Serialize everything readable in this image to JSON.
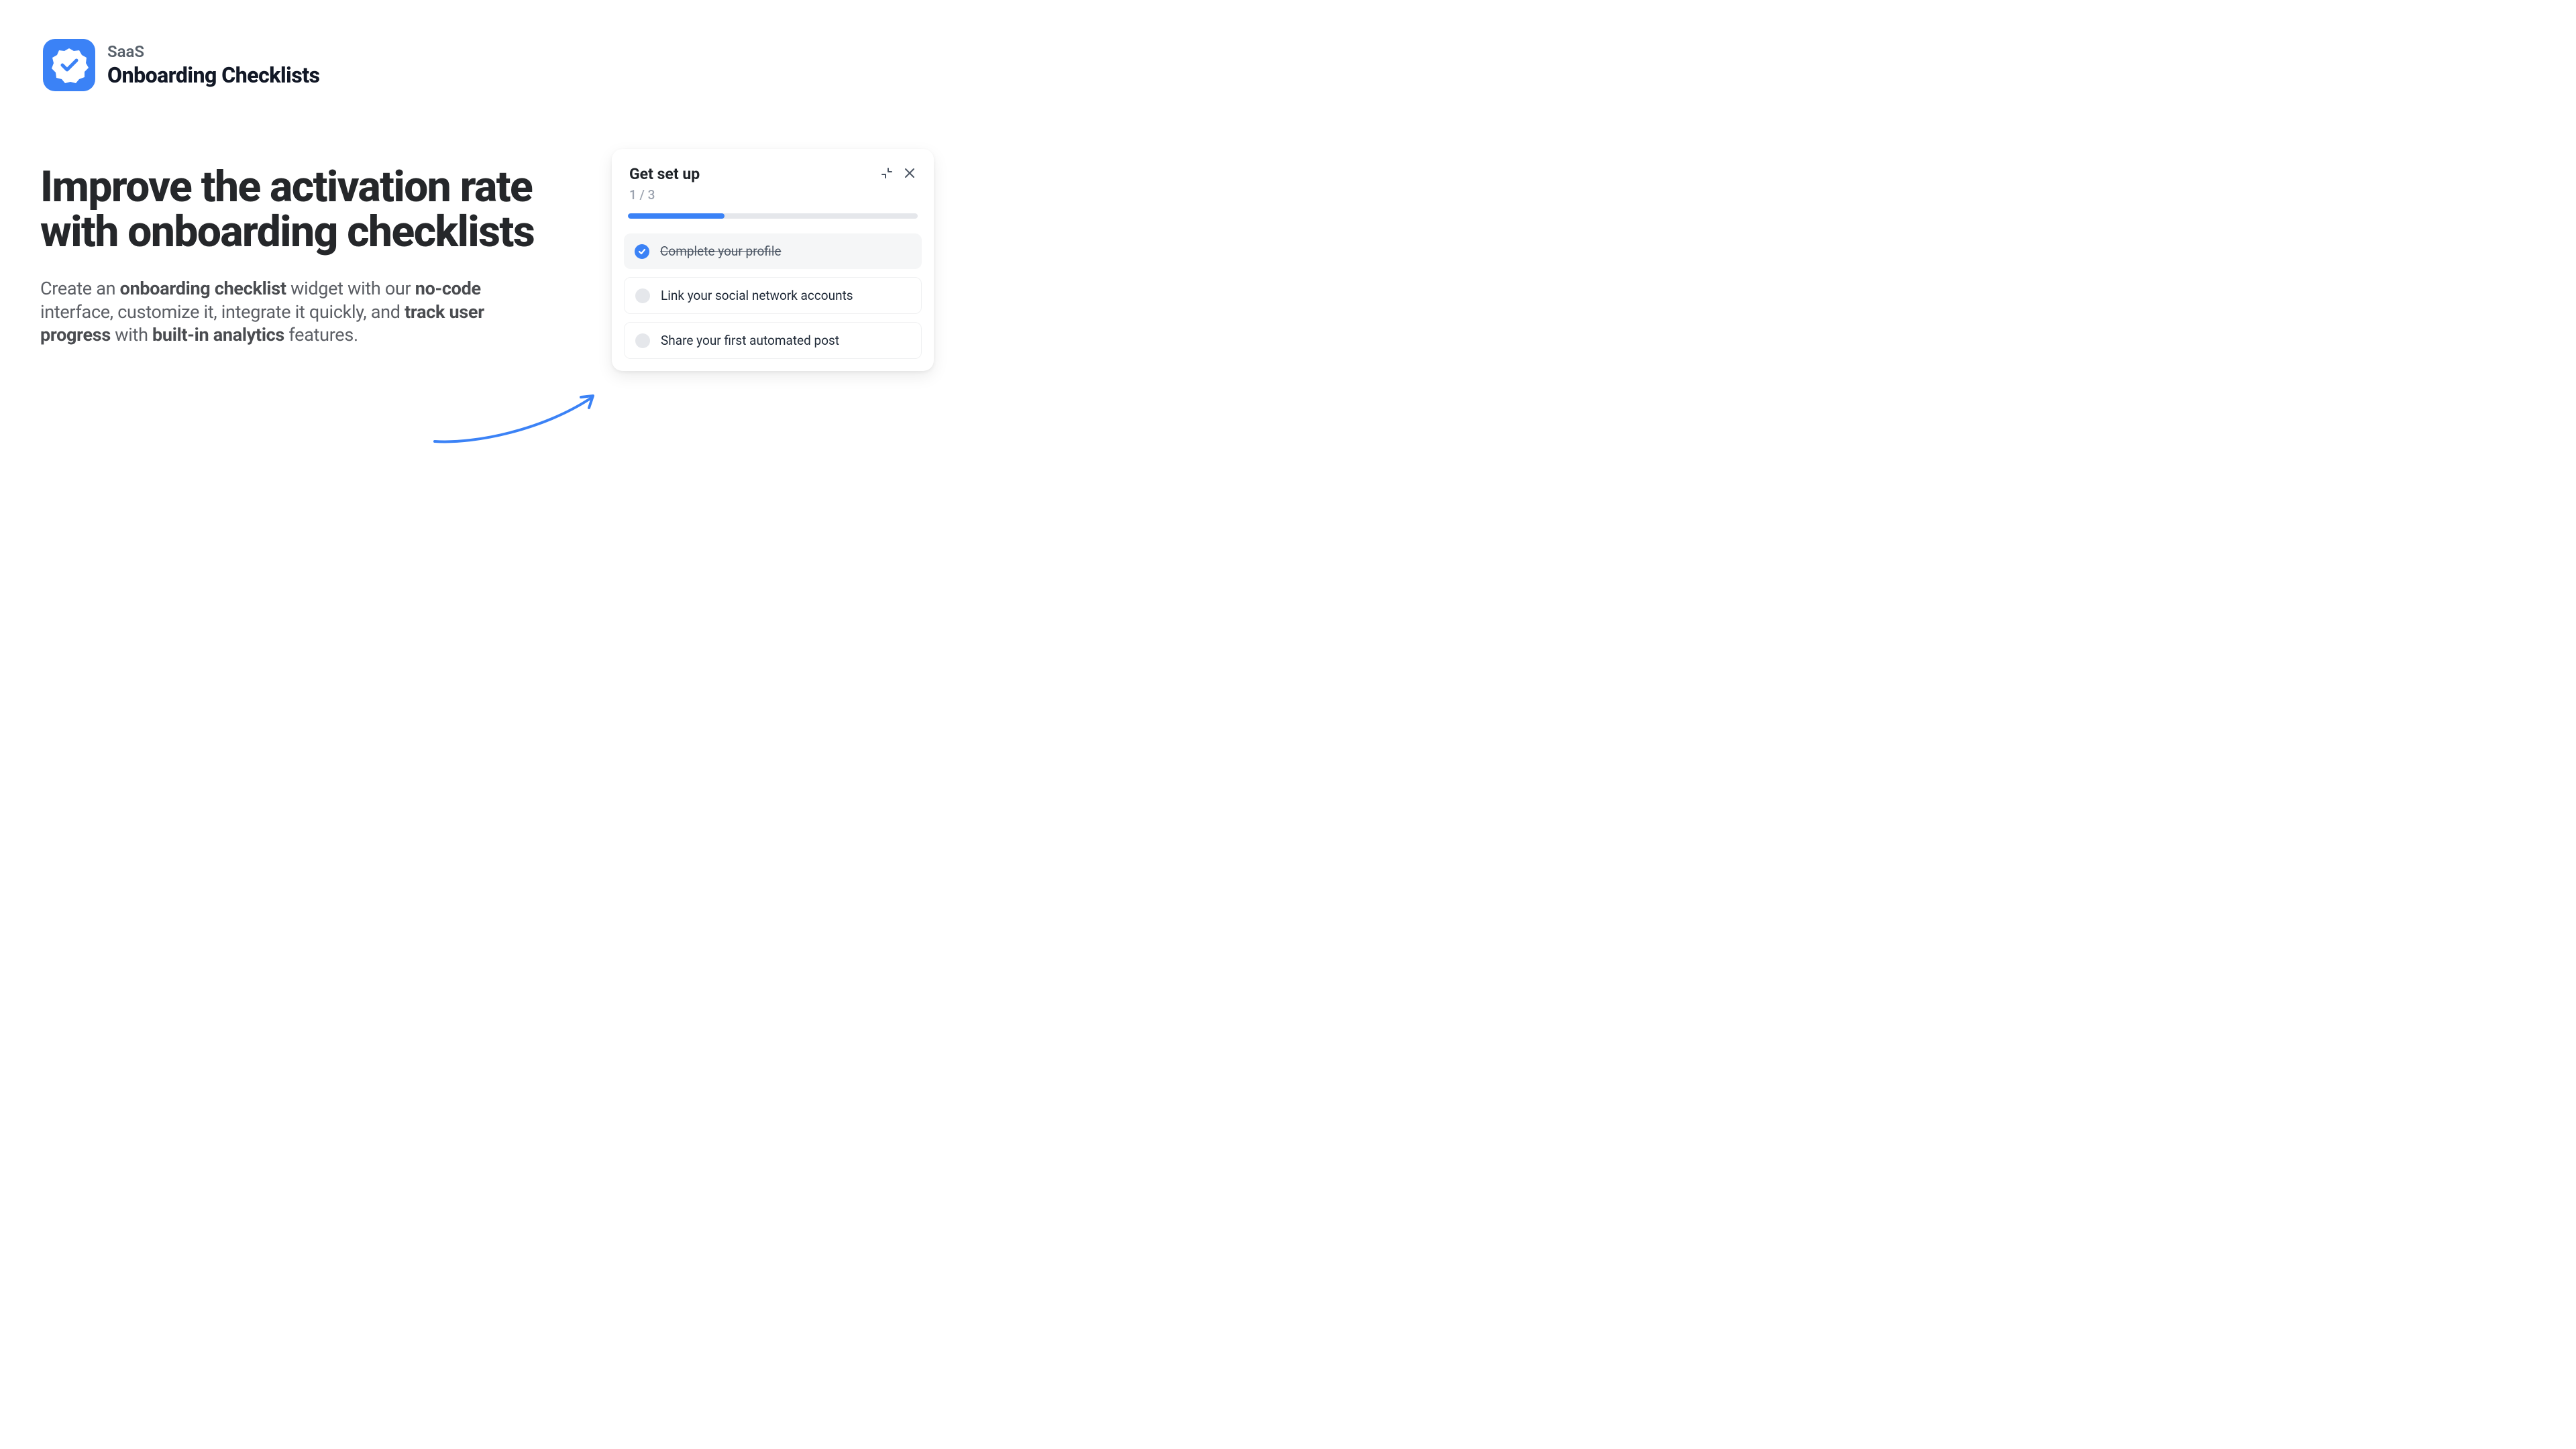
{
  "header": {
    "subtitle": "SaaS",
    "title": "Onboarding Checklists"
  },
  "hero": {
    "headline": "Improve the activation rate with onboarding checklists",
    "sub_part1": "Create an ",
    "sub_bold1": "onboarding checklist",
    "sub_part2": " widget with our ",
    "sub_bold2": "no-code",
    "sub_part3": " interface, customize it, integrate it quickly, and ",
    "sub_bold3": "track user progress",
    "sub_part4": " with ",
    "sub_bold4": "built-in analytics",
    "sub_part5": " features."
  },
  "widget": {
    "title": "Get set up",
    "counter": "1 / 3",
    "progress_percent": 33.33,
    "items": [
      {
        "label": "Complete your profile",
        "done": true
      },
      {
        "label": "Link your social network accounts",
        "done": false
      },
      {
        "label": "Share your first automated post",
        "done": false
      }
    ]
  },
  "colors": {
    "accent": "#3b82f6"
  }
}
